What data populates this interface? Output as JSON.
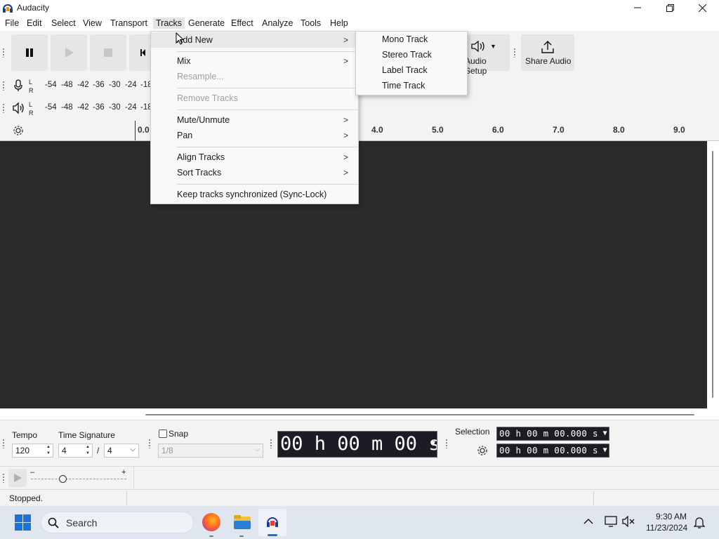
{
  "window": {
    "title": "Audacity"
  },
  "menubar": [
    "File",
    "Edit",
    "Select",
    "View",
    "Transport",
    "Tracks",
    "Generate",
    "Effect",
    "Analyze",
    "Tools",
    "Help"
  ],
  "toolbar": {
    "audio_setup_label": "Audio Setup",
    "share_audio_label": "Share Audio"
  },
  "meters": {
    "record_scale": [
      "-54",
      "-48",
      "-42",
      "-36",
      "-30",
      "-24",
      "-18"
    ],
    "play_scale": [
      "-54",
      "-48",
      "-42",
      "-36",
      "-30",
      "-24",
      "-18"
    ],
    "l": "L",
    "r": "R"
  },
  "ruler": {
    "labels": [
      "0.0",
      "4.0",
      "5.0",
      "6.0",
      "7.0",
      "8.0",
      "9.0"
    ]
  },
  "tracks_menu": {
    "items": [
      {
        "label": "Add New",
        "submenu": true,
        "disabled": false
      },
      {
        "label": "Mix",
        "submenu": true,
        "disabled": false
      },
      {
        "label": "Resample...",
        "submenu": false,
        "disabled": true
      },
      {
        "label": "Remove Tracks",
        "submenu": false,
        "disabled": true
      },
      {
        "label": "Mute/Unmute",
        "submenu": true,
        "disabled": false
      },
      {
        "label": "Pan",
        "submenu": true,
        "disabled": false
      },
      {
        "label": "Align Tracks",
        "submenu": true,
        "disabled": false
      },
      {
        "label": "Sort Tracks",
        "submenu": true,
        "disabled": false
      },
      {
        "label": "Keep tracks synchronized (Sync-Lock)",
        "submenu": false,
        "disabled": false
      }
    ]
  },
  "add_new_submenu": [
    "Mono Track",
    "Stereo Track",
    "Label Track",
    "Time Track"
  ],
  "bottom": {
    "tempo_label": "Tempo",
    "tempo_value": "120",
    "time_sig_label": "Time Signature",
    "time_sig_num": "4",
    "time_sig_slash": "/",
    "time_sig_den": "4",
    "snap_label": "Snap",
    "snap_value": "1/8",
    "time_display": "00 h 00 m 00 s",
    "selection_label": "Selection",
    "selection_start": "00 h 00 m 00.000 s",
    "selection_end": "00 h 00 m 00.000 s"
  },
  "speed": {
    "minus": "–",
    "plus": "+"
  },
  "status": {
    "text": "Stopped."
  },
  "taskbar": {
    "search_placeholder": "Search",
    "time": "9:30 AM",
    "date": "11/23/2024"
  }
}
